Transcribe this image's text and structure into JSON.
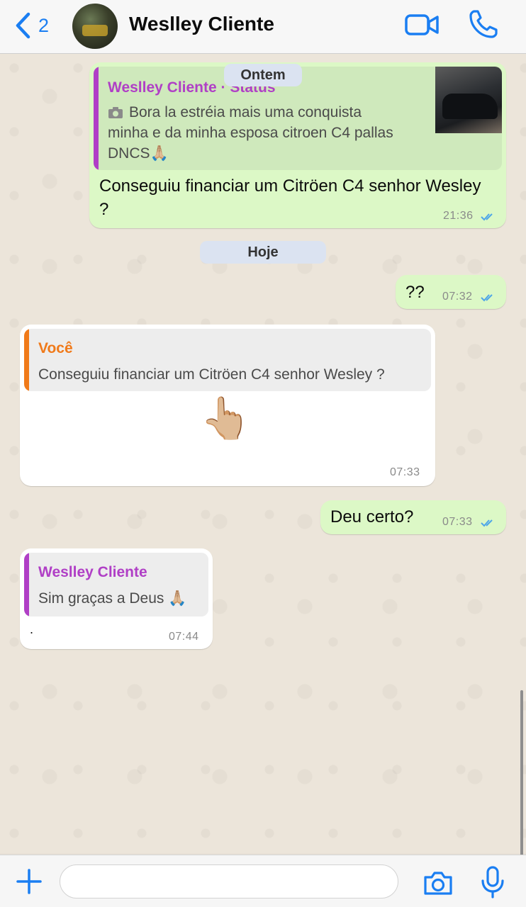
{
  "header": {
    "back_count": "2",
    "contact_name": "Weslley Cliente"
  },
  "chat": {
    "date_yesterday": "Ontem",
    "date_today": "Hoje",
    "messages": [
      {
        "direction": "out",
        "quote_author": "Weslley Cliente · Status",
        "quote_icon": "camera-icon",
        "quote_text": "Bora la estréia  mais uma conquista minha e da minha esposa  citroen C4 pallas DNCS🙏🏼",
        "text": "Conseguiu financiar um Citröen C4 senhor Wesley ?",
        "time": "21:36",
        "status": "read"
      },
      {
        "direction": "out",
        "text": "??",
        "time": "07:32",
        "status": "read"
      },
      {
        "direction": "in",
        "quote_author": "Você",
        "quote_text": "Conseguiu financiar um Citröen C4 senhor Wesley ?",
        "text": "👆🏼",
        "time": "07:33"
      },
      {
        "direction": "out",
        "text": "Deu certo?",
        "time": "07:33",
        "status": "read"
      },
      {
        "direction": "in",
        "quote_author": "Weslley Cliente",
        "quote_text": "Sim graças  a Deus 🙏🏼",
        "text": ".",
        "time": "07:44"
      }
    ]
  },
  "input": {
    "placeholder": ""
  },
  "colors": {
    "accent": "#1a7ef2",
    "outgoing_bubble": "#dcf8c6",
    "incoming_bubble": "#ffffff",
    "chat_bg": "#ece5da",
    "quote_purple": "#b03fc6",
    "quote_orange": "#f07a1a",
    "read_ticks": "#4fa6e8"
  }
}
